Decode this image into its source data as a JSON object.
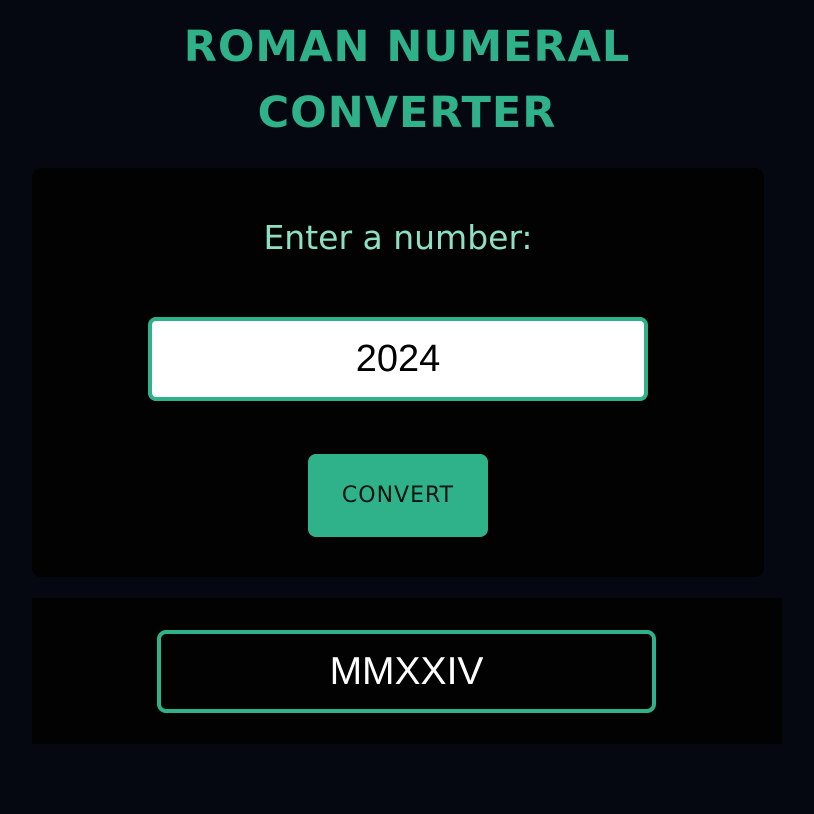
{
  "page": {
    "title_line1": "ROMAN NUMERAL",
    "title_line2": "CONVERTER"
  },
  "form": {
    "label": "Enter a number:",
    "input_value": "2024",
    "button_label": "CONVERT"
  },
  "output": {
    "value": "MMXXIV"
  },
  "colors": {
    "background": "#050810",
    "panel": "#010201",
    "accent": "#2fb28a",
    "label_text": "#8de0c1",
    "output_text": "#ffffff"
  }
}
